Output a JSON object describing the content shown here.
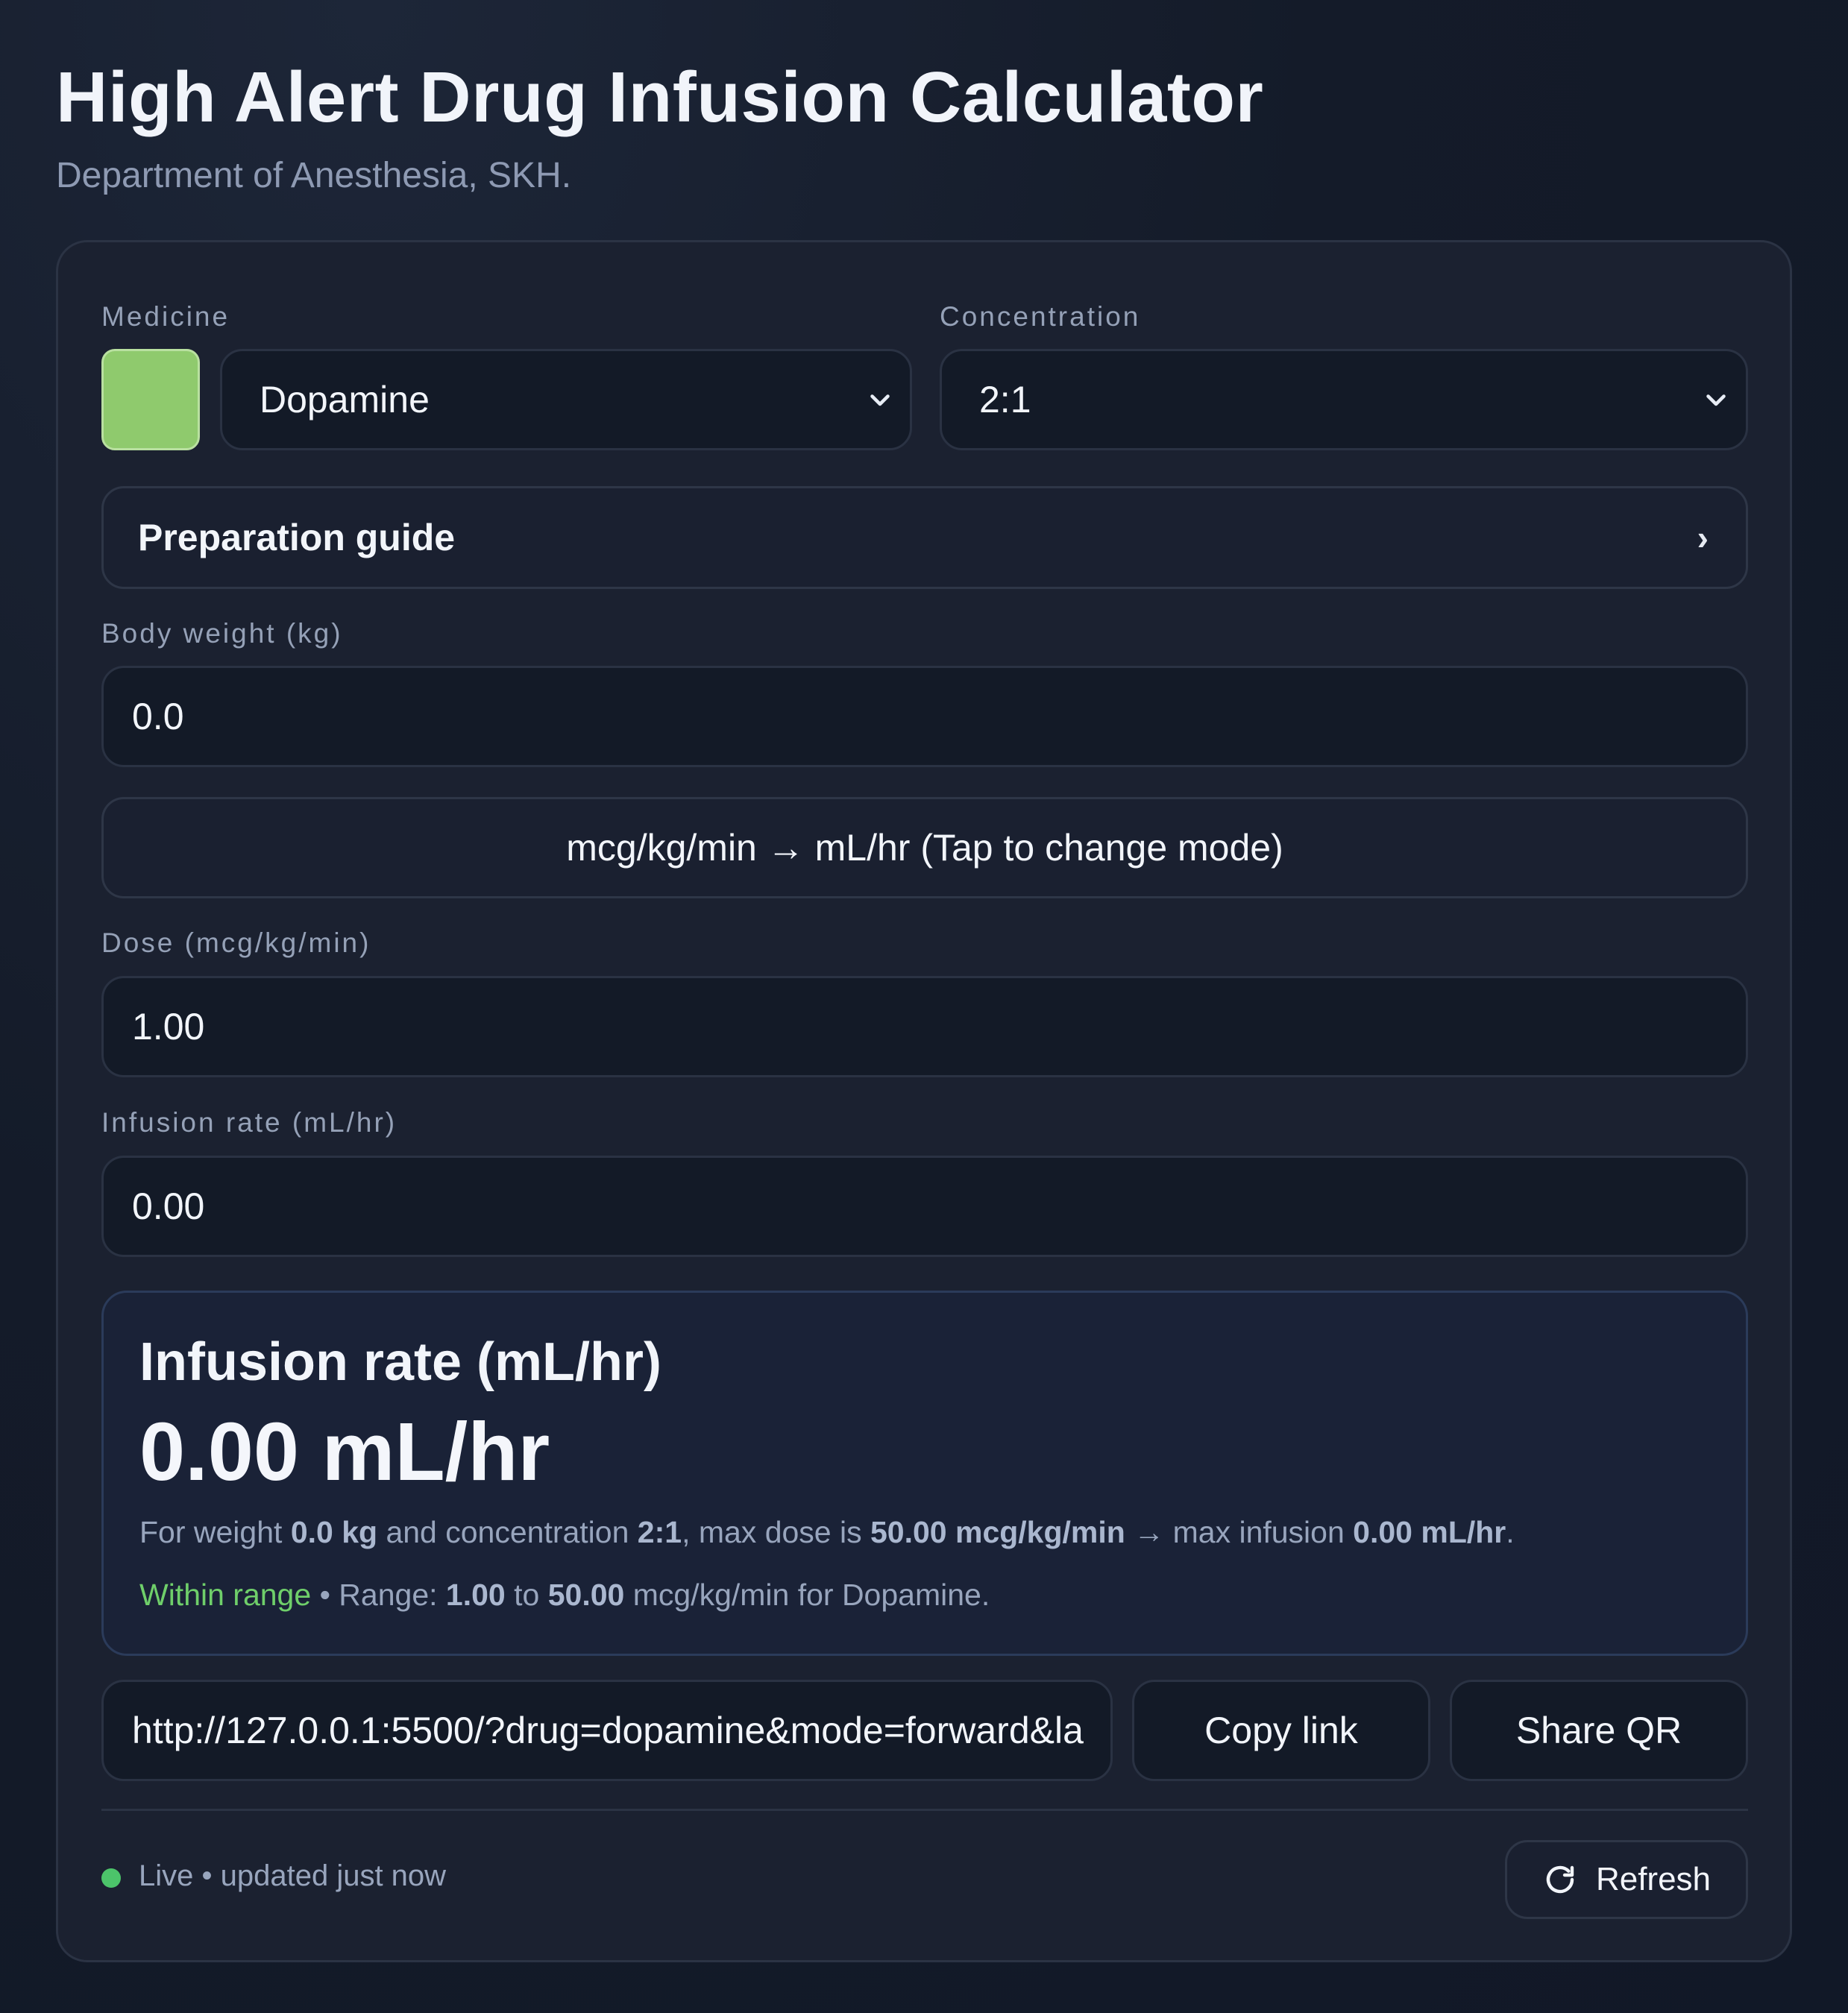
{
  "header": {
    "title": "High Alert Drug Infusion Calculator",
    "subtitle": "Department of Anesthesia, SKH."
  },
  "medicine": {
    "label": "Medicine",
    "value": "Dopamine",
    "swatch_color": "#8fca6d"
  },
  "concentration": {
    "label": "Concentration",
    "value": "2:1"
  },
  "preparation_guide": {
    "label": "Preparation guide",
    "arrow": "›"
  },
  "body_weight": {
    "label": "Body weight (kg)",
    "value": "0.0"
  },
  "mode_toggle": {
    "label": "mcg/kg/min → mL/hr (Tap to change mode)"
  },
  "dose": {
    "label": "Dose (mcg/kg/min)",
    "value": "1.00"
  },
  "infusion_rate": {
    "label": "Infusion rate (mL/hr)",
    "value": "0.00"
  },
  "result": {
    "title": "Infusion rate (mL/hr)",
    "value": "0.00 mL/hr",
    "note_prefix": "For weight ",
    "weight": "0.0 kg",
    "note_mid1": " and concentration ",
    "concentration": "2:1",
    "note_mid2": ", max dose is ",
    "max_dose": "50.00 mcg/kg/min",
    "note_mid3": " → max infusion ",
    "max_infusion": "0.00 mL/hr",
    "note_end": ".",
    "status": "Within range",
    "range_prefix": " • Range: ",
    "range_low": "1.00",
    "range_to": " to ",
    "range_high": "50.00",
    "range_suffix": " mcg/kg/min for Dopamine."
  },
  "share": {
    "url": "http://127.0.0.1:5500/?drug=dopamine&mode=forward&la",
    "copy_label": "Copy link",
    "qr_label": "Share QR"
  },
  "footer": {
    "live_text": "Live • updated just now",
    "refresh_label": "Refresh",
    "status_color": "#4cc46a"
  }
}
